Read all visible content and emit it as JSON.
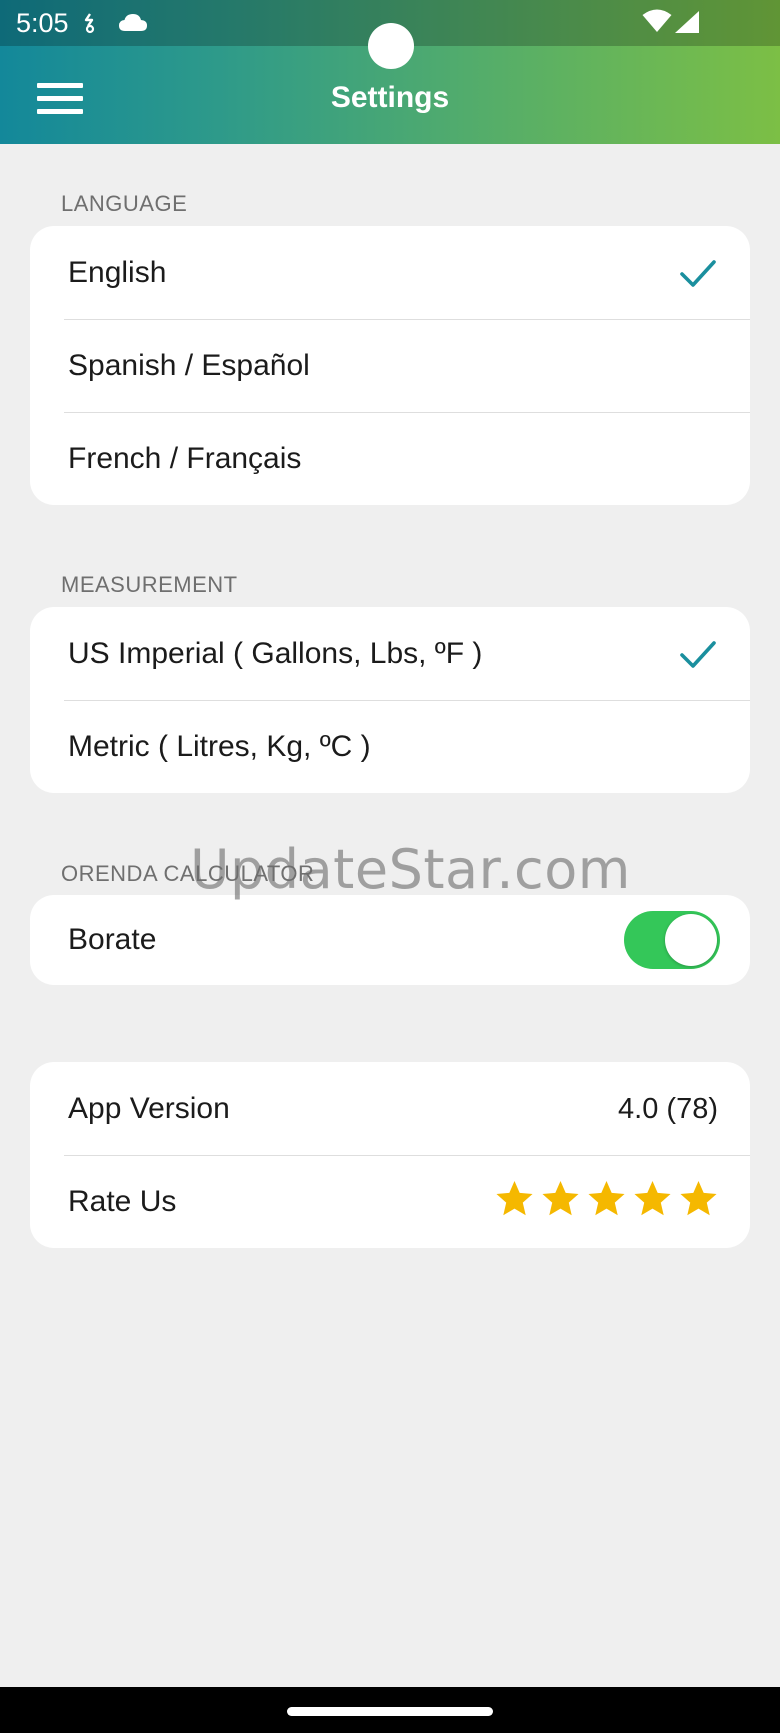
{
  "status_bar": {
    "time": "5:05",
    "icons": [
      "activity-icon",
      "cloud-icon",
      "wifi-icon",
      "cellular-signal-icon"
    ]
  },
  "app_bar": {
    "title": "Settings",
    "menu_icon": "hamburger-menu-icon"
  },
  "colors": {
    "gradient_start": "#13889a",
    "gradient_end": "#7cbf45",
    "check": "#1a8f9e",
    "toggle_on": "#34c759",
    "star": "#f5b800",
    "background": "#efefef"
  },
  "language": {
    "header": "LANGUAGE",
    "options": [
      {
        "label": "English",
        "selected": true
      },
      {
        "label": "Spanish / Español",
        "selected": false
      },
      {
        "label": "French / Français",
        "selected": false
      }
    ]
  },
  "measurement": {
    "header": "MEASUREMENT",
    "options": [
      {
        "label": "US Imperial ( Gallons, Lbs, ºF )",
        "selected": true
      },
      {
        "label": "Metric ( Litres, Kg, ºC )",
        "selected": false
      }
    ]
  },
  "orenda_calculator": {
    "header": "ORENDA CALCULATOR",
    "borate": {
      "label": "Borate",
      "enabled": true
    }
  },
  "about": {
    "app_version": {
      "label": "App Version",
      "value": "4.0 (78)"
    },
    "rate_us": {
      "label": "Rate Us",
      "stars": 5,
      "max_stars": 5
    }
  },
  "watermark": "UpdateStar.com"
}
